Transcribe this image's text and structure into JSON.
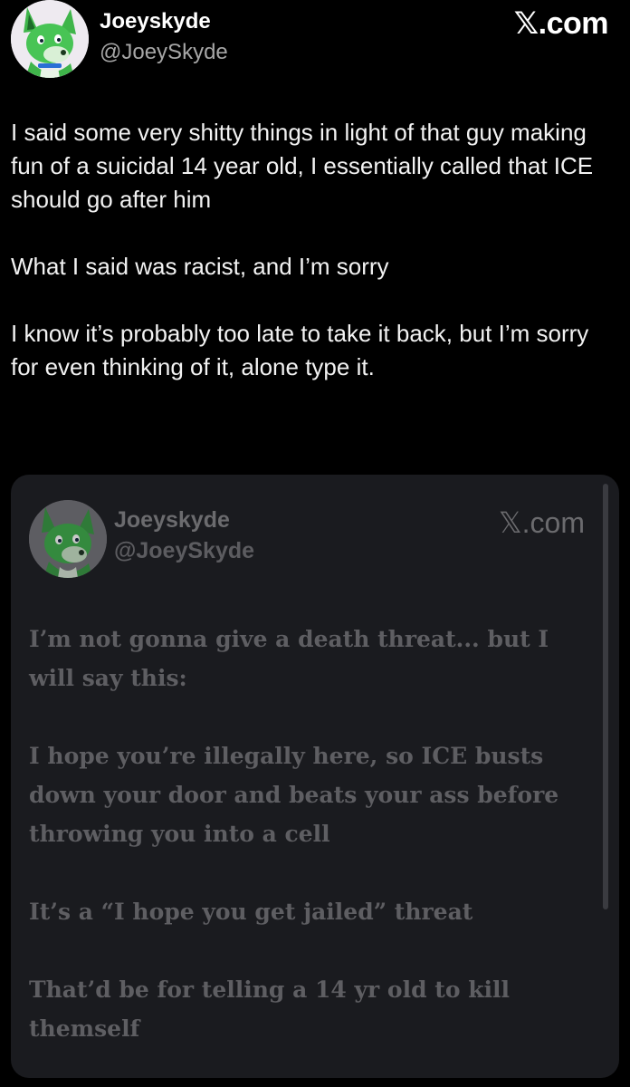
{
  "post": {
    "author_name": "Joeyskyde",
    "author_handle": "@JoeySkyde",
    "brand": ".com",
    "brand_mark": "𝕏",
    "paragraphs": [
      "I said some very shitty things in light of that guy making fun of a suicidal 14 year old, I essentially called that ICE should go after him",
      "What I said was racist, and I’m sorry",
      "I know it’s probably too late to take it back, but I’m sorry for even thinking of it, alone type it."
    ],
    "avatar_icon": "green-fox-avatar-icon"
  },
  "quoted": {
    "author_name": "Joeyskyde",
    "author_handle": "@JoeySkyde",
    "brand": ".com",
    "brand_mark": "𝕏",
    "paragraphs": [
      "I’m not gonna give a death threat... but I will say this:",
      "I hope you’re illegally here, so ICE busts down your door and beats your ass before throwing you into a cell",
      "It’s a “I hope you get jailed” threat",
      "That’d be for telling a 14 yr old to kill themself"
    ],
    "avatar_icon": "green-fox-avatar-icon"
  },
  "colors": {
    "background": "#000000",
    "card": "#1a1b1f",
    "avatar_fox": "#3fb54a",
    "handle": "#a6a6a6"
  }
}
